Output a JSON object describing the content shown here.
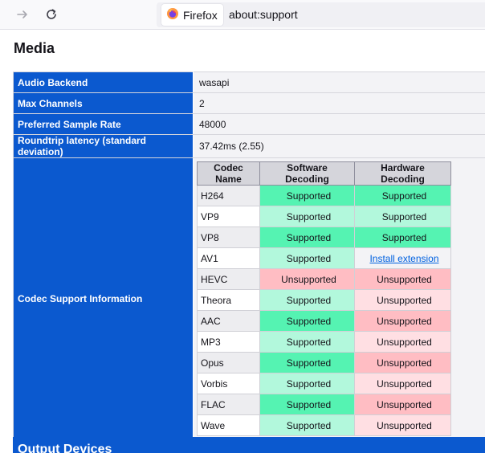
{
  "toolbar": {
    "back_icon": "arrow-right-icon",
    "reload_icon": "reload-icon",
    "identity_label": "Firefox",
    "url": "about:support"
  },
  "page": {
    "heading": "Media"
  },
  "media": {
    "rows": [
      {
        "label": "Audio Backend",
        "value": "wasapi"
      },
      {
        "label": "Max Channels",
        "value": "2"
      },
      {
        "label": "Preferred Sample Rate",
        "value": "48000"
      },
      {
        "label": "Roundtrip latency (standard deviation)",
        "value": "37.42ms (2.55)"
      }
    ],
    "codec_label": "Codec Support Information"
  },
  "codec_table": {
    "headers": [
      "Codec Name",
      "Software Decoding",
      "Hardware Decoding"
    ],
    "rows": [
      {
        "name": "H264",
        "software": "Supported",
        "hardware": "Supported"
      },
      {
        "name": "VP9",
        "software": "Supported",
        "hardware": "Supported"
      },
      {
        "name": "VP8",
        "software": "Supported",
        "hardware": "Supported"
      },
      {
        "name": "AV1",
        "software": "Supported",
        "hardware": "Install extension"
      },
      {
        "name": "HEVC",
        "software": "Unsupported",
        "hardware": "Unsupported"
      },
      {
        "name": "Theora",
        "software": "Supported",
        "hardware": "Unsupported"
      },
      {
        "name": "AAC",
        "software": "Supported",
        "hardware": "Unsupported"
      },
      {
        "name": "MP3",
        "software": "Supported",
        "hardware": "Unsupported"
      },
      {
        "name": "Opus",
        "software": "Supported",
        "hardware": "Unsupported"
      },
      {
        "name": "Vorbis",
        "software": "Supported",
        "hardware": "Unsupported"
      },
      {
        "name": "FLAC",
        "software": "Supported",
        "hardware": "Unsupported"
      },
      {
        "name": "Wave",
        "software": "Supported",
        "hardware": "Unsupported"
      }
    ]
  },
  "section": {
    "next_title": "Output Devices"
  },
  "colors": {
    "header_blue": "#0b59cf",
    "supported_strong": "#55f3b2",
    "supported_light": "#b2f8dc",
    "unsupported_strong": "#ffbdc3",
    "unsupported_light": "#ffdfe3",
    "link": "#0061e0"
  }
}
